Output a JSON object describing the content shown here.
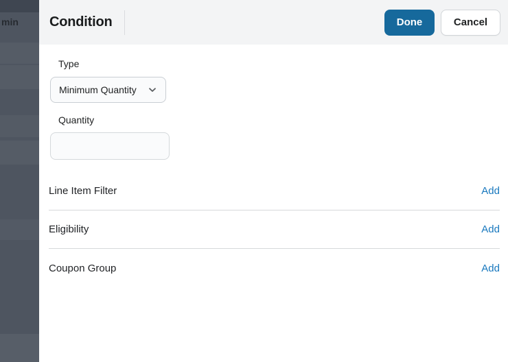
{
  "sidebar": {
    "partial_text": "min"
  },
  "header": {
    "title": "Condition",
    "buttons": {
      "done": "Done",
      "cancel": "Cancel"
    }
  },
  "form": {
    "type": {
      "label": "Type",
      "value": "Minimum Quantity"
    },
    "quantity": {
      "label": "Quantity",
      "value": "",
      "placeholder": ""
    }
  },
  "sections": [
    {
      "label": "Line Item Filter",
      "action_label": "Add"
    },
    {
      "label": "Eligibility",
      "action_label": "Add"
    },
    {
      "label": "Coupon Group",
      "action_label": "Add"
    }
  ],
  "colors": {
    "primary_button": "#16699c",
    "link": "#1878be",
    "sidebar": "#4e5560",
    "header_bg": "#f3f4f5"
  }
}
